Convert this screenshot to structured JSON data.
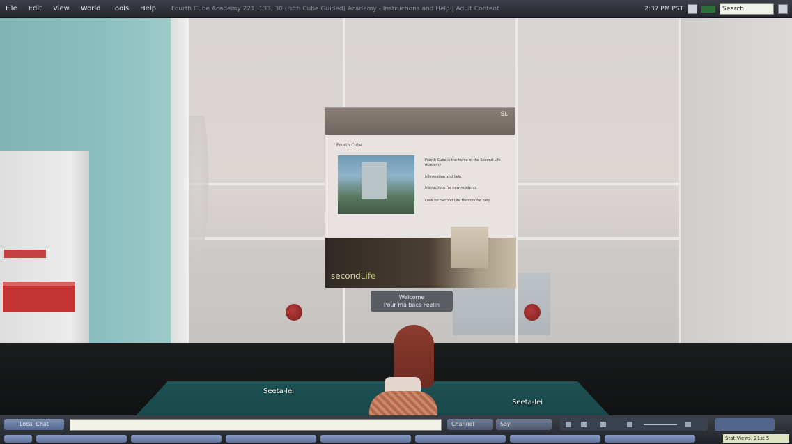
{
  "menu": {
    "items": [
      "File",
      "Edit",
      "View",
      "World",
      "Tools",
      "Help"
    ],
    "location": "Fourth Cube Academy 221, 133, 30 (Fifth Cube Guided) Academy - Instructions and Help | Adult Content"
  },
  "top_right": {
    "clock": "2:37 PM PST",
    "search_value": "Search"
  },
  "scene": {
    "floor_labels": [
      "Seeta-lei",
      "Seeta-lei"
    ],
    "board": {
      "title": "Fourth Cube",
      "bullets": [
        "Fourth Cube is the home of the Second Life Academy",
        "Information and help",
        "Instructions for new residents",
        "Look for Second Life Mentors for help"
      ],
      "brand": "secondlife",
      "brand_part1": "second",
      "brand_part2": "Life",
      "logo": "SL"
    },
    "tooltip_line1": "Welcome",
    "tooltip_line2": "Pour ma bacs Feelin"
  },
  "chatbar": {
    "local_chat": "Local Chat",
    "channel": "Channel",
    "say": "Say"
  },
  "taskbar": {
    "stats": "Stat Views: 21st 5"
  }
}
